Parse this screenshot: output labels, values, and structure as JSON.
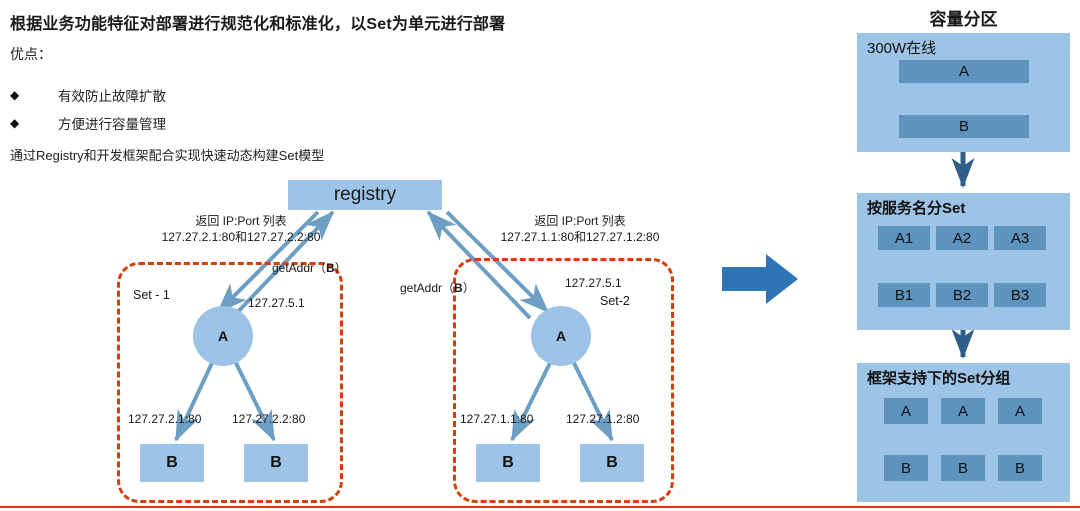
{
  "slide": {
    "headline": "根据业务功能特征对部署进行规范化和标准化，以Set为单元进行部署",
    "pros_label": "优点：",
    "bullets": [
      {
        "mark": "◆",
        "text": "有效防止故障扩散"
      },
      {
        "mark": "◆",
        "text": "方便进行容量管理"
      }
    ],
    "sub_note": "通过Registry和开发框架配合实现快速动态构建Set模型"
  },
  "diagram": {
    "registry_label": "registry",
    "sets": [
      {
        "id": "set-1",
        "label": "Set - 1",
        "return_line_1": "返回 IP:Port 列表",
        "return_line_2": "127.27.2.1:80和127.27.2.2:80",
        "getaddr_prefix": "getAddr（",
        "getaddr_arg": "B",
        "getaddr_suffix": "）",
        "node_ip": "127.27.5.1",
        "node_a_label": "A",
        "backends": [
          {
            "ip": "127.27.2.1:80",
            "label": "B"
          },
          {
            "ip": "127.27.2.2:80",
            "label": "B"
          }
        ]
      },
      {
        "id": "set-2",
        "label": "Set-2",
        "return_line_1": "返回 IP:Port 列表",
        "return_line_2": "127.27.1.1:80和127.27.1.2:80",
        "getaddr_prefix": "getAddr（",
        "getaddr_arg": "B",
        "getaddr_suffix": "）",
        "node_ip": "127.27.5.1",
        "node_a_label": "A",
        "backends": [
          {
            "ip": "127.27.1.1:80",
            "label": "B"
          },
          {
            "ip": "127.27.1.2:80",
            "label": "B"
          }
        ]
      }
    ]
  },
  "capacity": {
    "title": "容量分区",
    "panels": [
      {
        "heading": "300W在线",
        "rows": [
          [
            "A"
          ],
          [
            "B"
          ]
        ]
      },
      {
        "heading": "按服务名分Set",
        "rows": [
          [
            "A1",
            "A2",
            "A3"
          ],
          [
            "B1",
            "B2",
            "B3"
          ]
        ]
      },
      {
        "heading": "框架支持下的Set分组",
        "rows": [
          [
            "A",
            "A",
            "A"
          ],
          [
            "B",
            "B",
            "B"
          ]
        ]
      }
    ]
  },
  "colors": {
    "light_blue": "#9dc3e6",
    "mid_blue": "#5e93be",
    "arrow_blue": "#6d9fc4",
    "accent_blue": "#2e75b6",
    "dashed_red": "#d1410c",
    "footer_rule": "#d1410c"
  }
}
